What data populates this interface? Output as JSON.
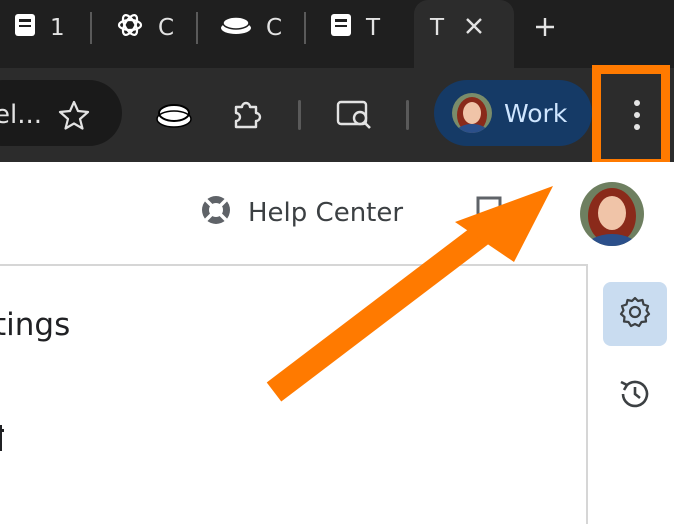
{
  "tabs": [
    {
      "icon": "document-icon",
      "label": "1"
    },
    {
      "icon": "chatgpt-icon",
      "label": "C"
    },
    {
      "icon": "button-icon",
      "label": "C"
    },
    {
      "icon": "document-icon",
      "label": "T"
    },
    {
      "icon": "document-icon",
      "label": "T",
      "active": true
    }
  ],
  "omnibox": {
    "text": "el..."
  },
  "profile": {
    "label": "Work"
  },
  "header": {
    "help_label": "Help Center"
  },
  "main": {
    "heading": "tings"
  },
  "colors": {
    "highlight": "#ff7a00",
    "chip_bg": "#153a66",
    "active_nav": "#c9dcf0"
  }
}
